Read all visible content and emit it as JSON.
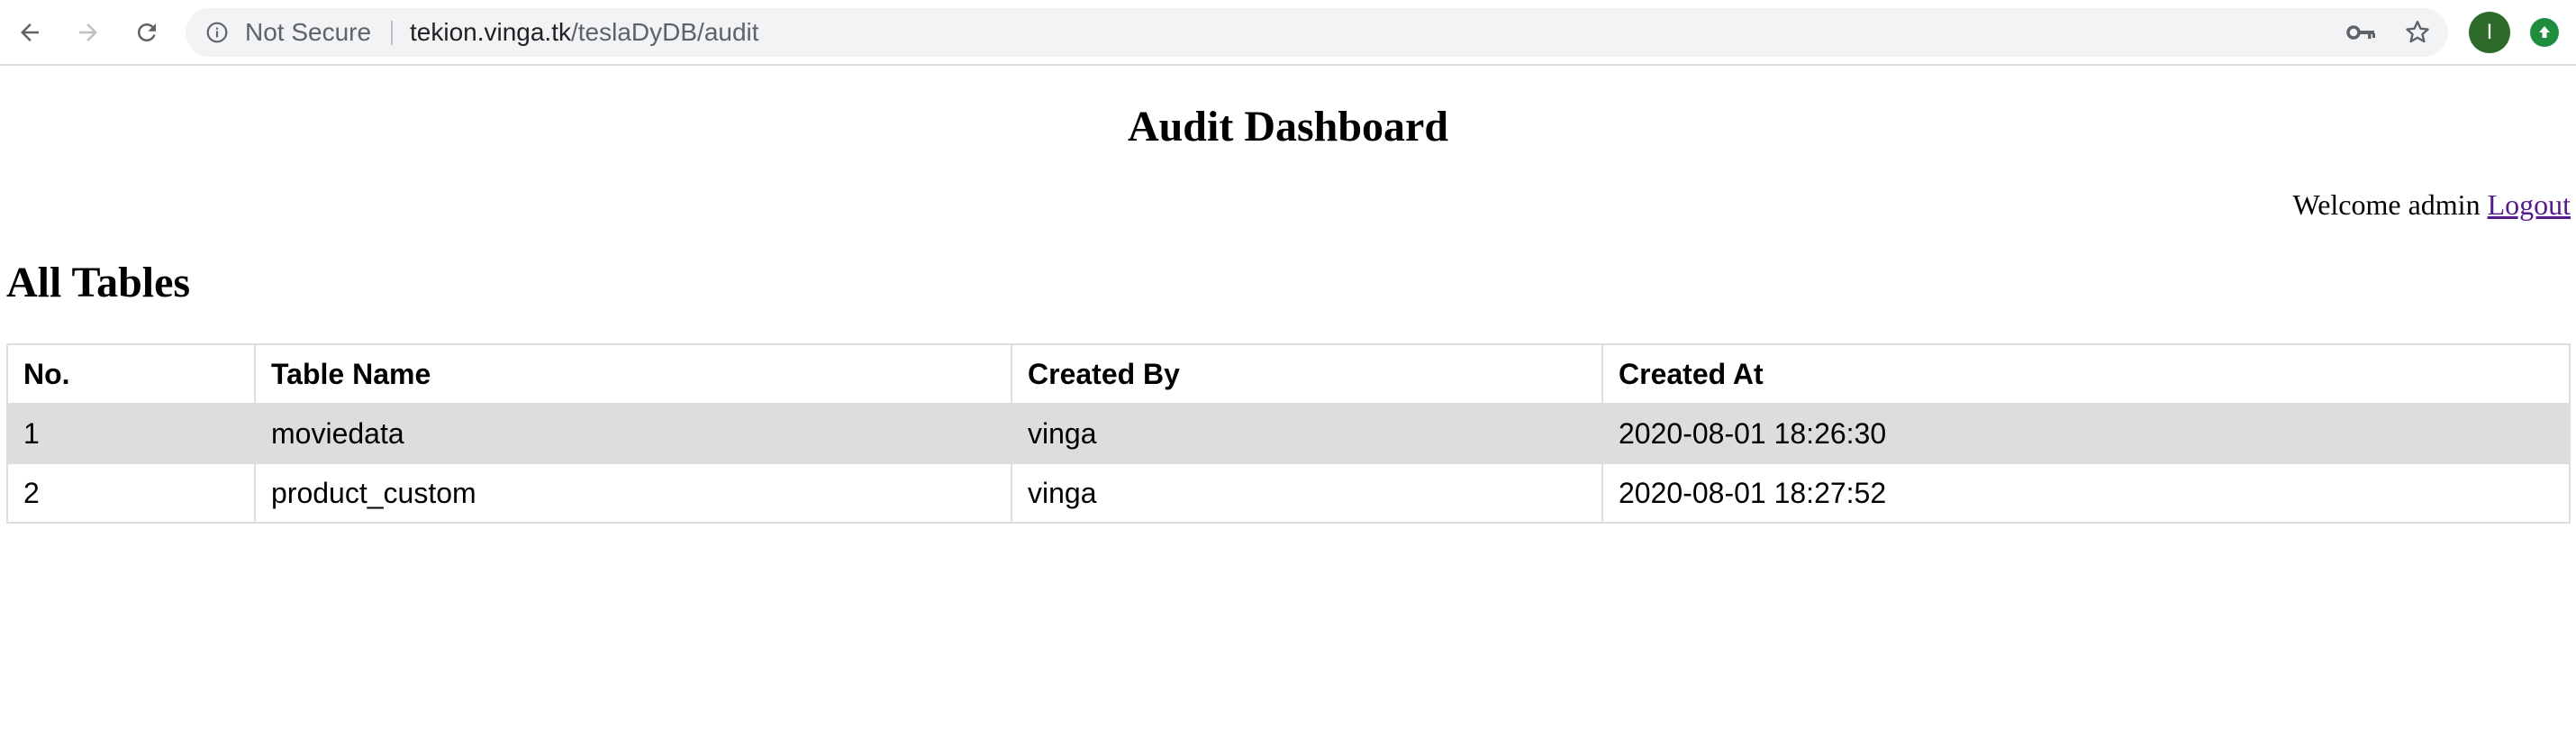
{
  "browser": {
    "security_label": "Not Secure",
    "url_host": "tekion.vinga.tk",
    "url_path": "/teslaDyDB/audit",
    "profile_initial": "I",
    "icons": {
      "back": "arrow-left-icon",
      "forward": "arrow-right-icon",
      "reload": "reload-icon",
      "info": "info-icon",
      "key": "key-icon",
      "bookmark": "star-icon",
      "update": "update-arrow-icon"
    },
    "colors": {
      "avatar": "#2e6b2b",
      "update": "#1e8e3e"
    }
  },
  "page": {
    "title": "Audit Dashboard",
    "welcome_text": "Welcome admin",
    "logout_label": "Logout",
    "section_heading": "All Tables"
  },
  "table": {
    "headers": {
      "no": "No.",
      "name": "Table Name",
      "created_by": "Created By",
      "created_at": "Created At"
    },
    "rows": [
      {
        "no": "1",
        "name": "moviedata",
        "created_by": "vinga",
        "created_at": "2020-08-01 18:26:30"
      },
      {
        "no": "2",
        "name": "product_custom",
        "created_by": "vinga",
        "created_at": "2020-08-01 18:27:52"
      }
    ]
  }
}
